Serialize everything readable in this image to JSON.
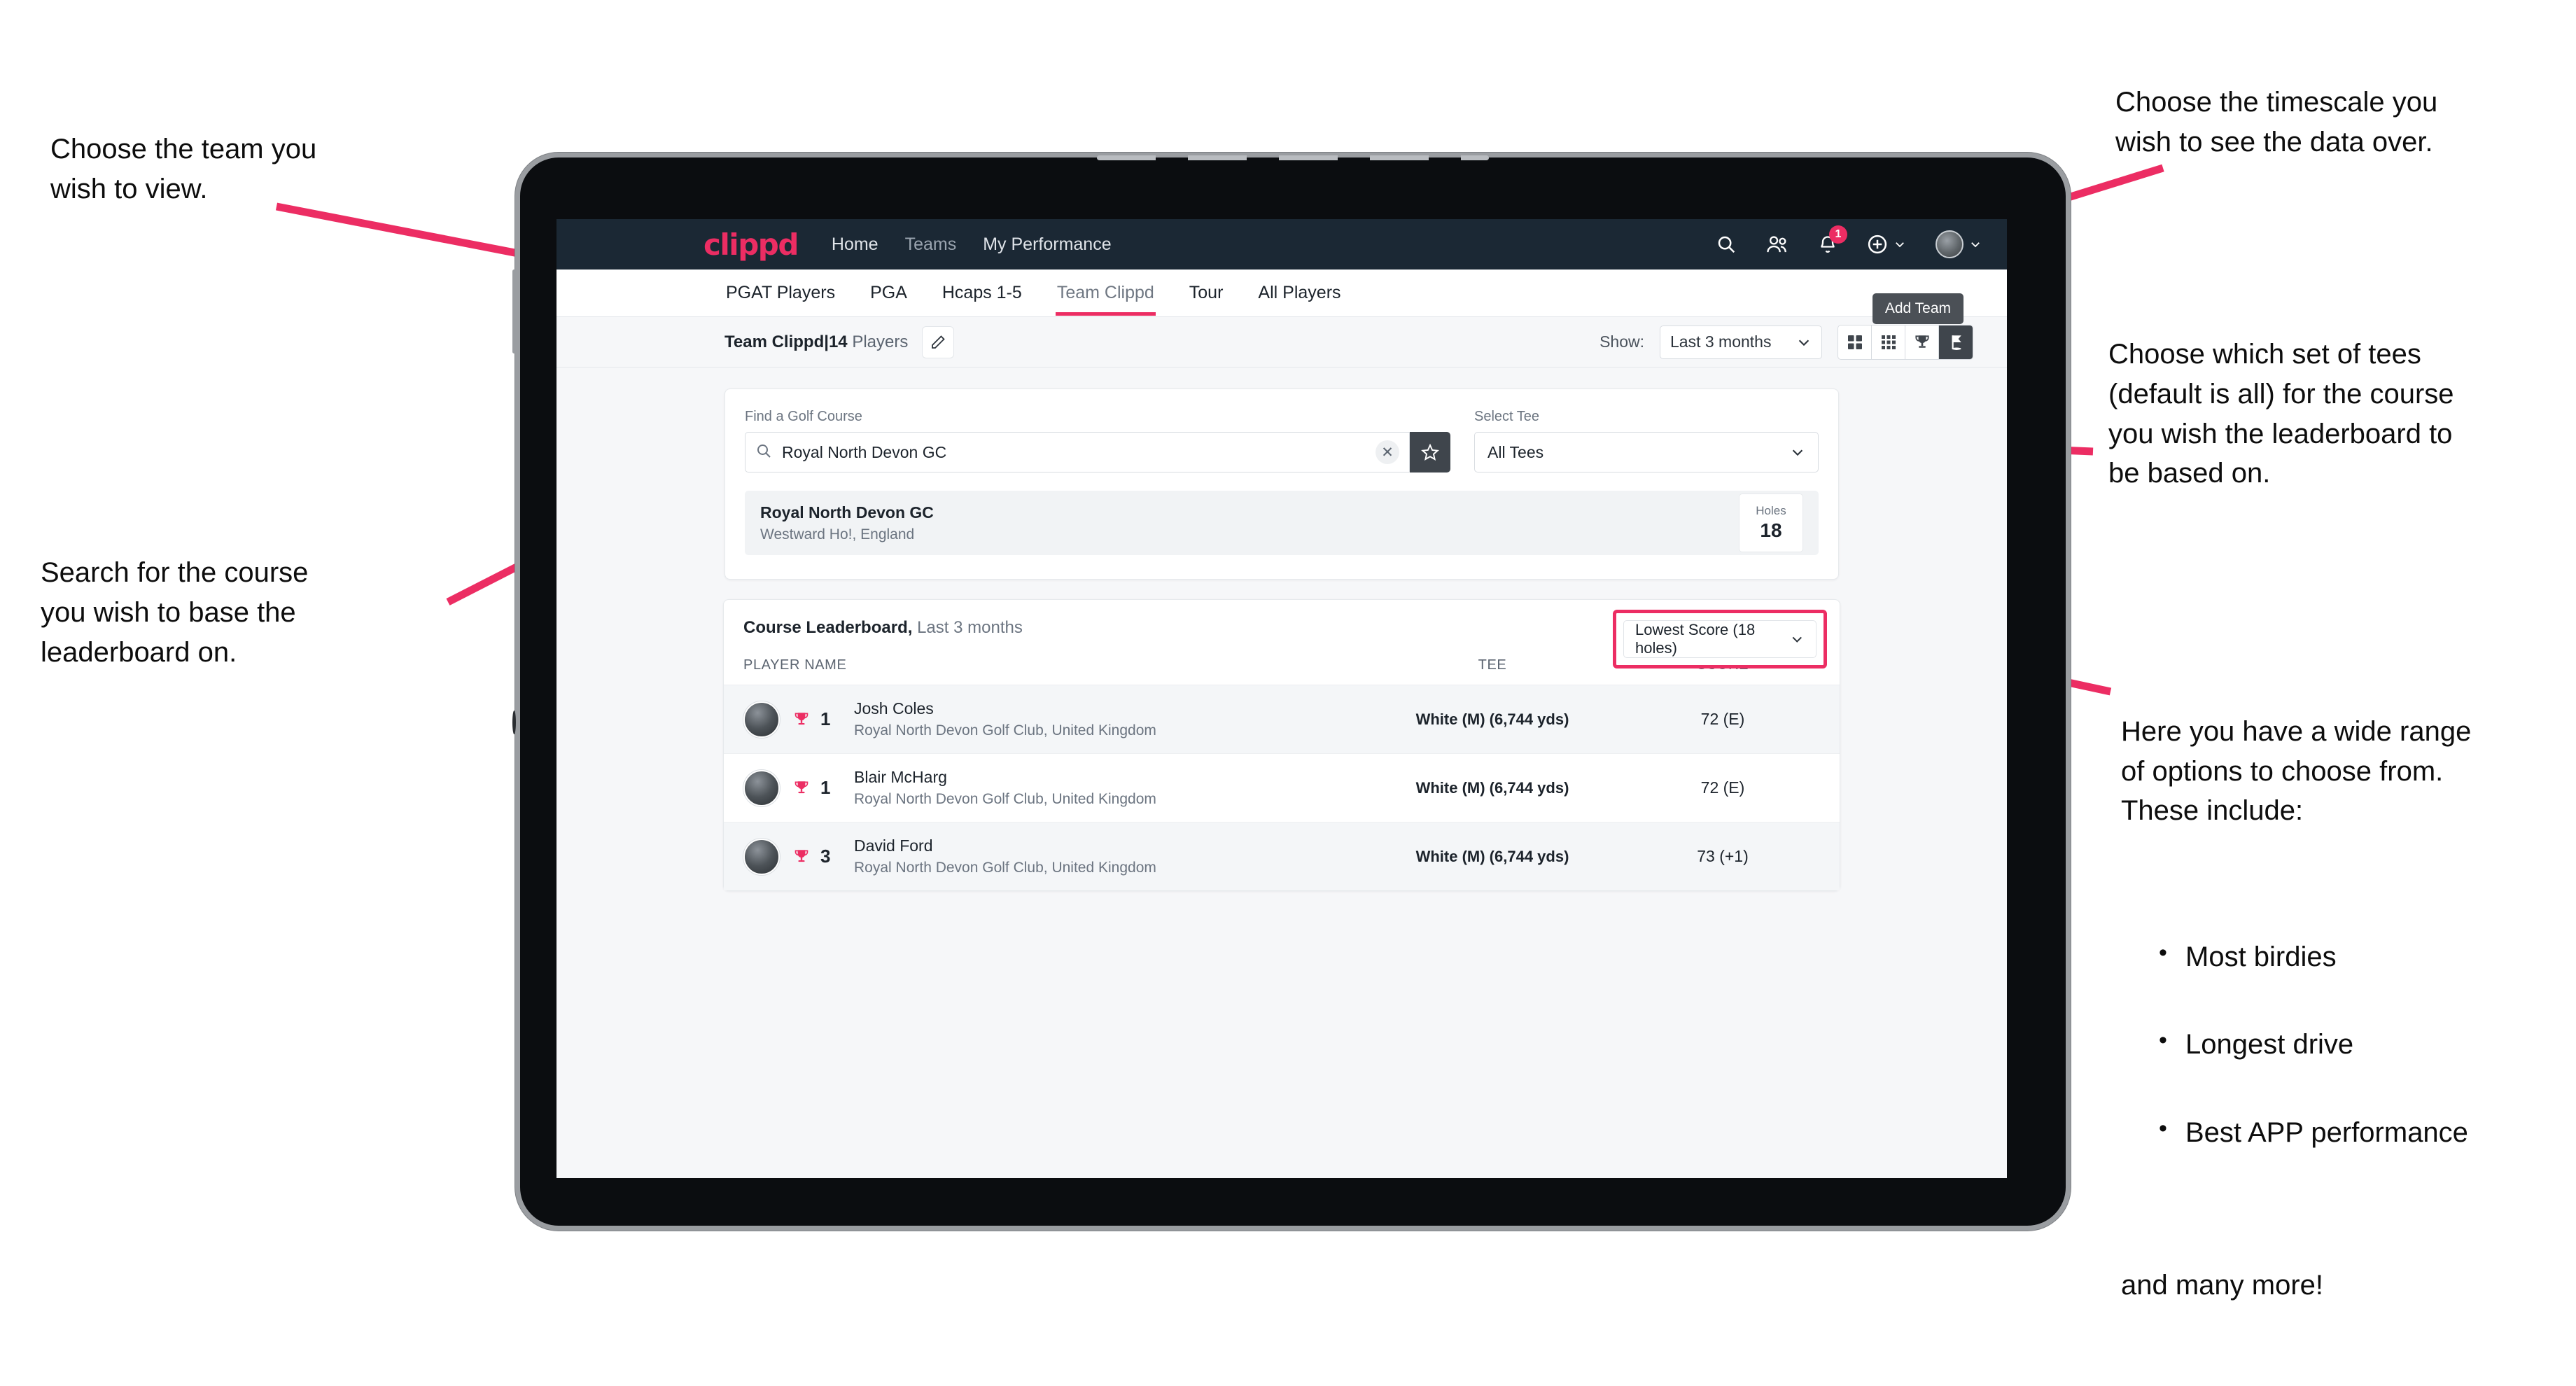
{
  "annotations": {
    "top_left": "Choose the team you\nwish to view.",
    "mid_left": "Search for the course\nyou wish to base the\nleaderboard on.",
    "top_right": "Choose the timescale you\nwish to see the data over.",
    "mid_right": "Choose which set of tees\n(default is all) for the course\nyou wish the leaderboard to\nbe based on.",
    "bottom_right_intro": "Here you have a wide range\nof options to choose from.\nThese include:",
    "bottom_right_bullets": [
      "Most birdies",
      "Longest drive",
      "Best APP performance"
    ],
    "bottom_right_tail": "and many more!"
  },
  "app": {
    "brand": "clippd",
    "nav_links": [
      {
        "label": "Home",
        "muted": false
      },
      {
        "label": "Teams",
        "muted": true
      },
      {
        "label": "My Performance",
        "muted": false
      }
    ],
    "nav_icons": [
      {
        "name": "search-icon"
      },
      {
        "name": "people-icon"
      },
      {
        "name": "notifications-bell-icon",
        "badge": "1"
      },
      {
        "name": "add-circle-icon"
      },
      {
        "name": "profile-avatar"
      }
    ],
    "tabs": [
      {
        "label": "PGAT Players",
        "active": false
      },
      {
        "label": "PGA",
        "active": false
      },
      {
        "label": "Hcaps 1-5",
        "active": false
      },
      {
        "label": "Team Clippd",
        "active": true
      },
      {
        "label": "Tour",
        "active": false
      },
      {
        "label": "All Players",
        "active": false
      }
    ],
    "tooltip": "Add Team",
    "toolbar": {
      "team_name": "Team Clippd",
      "separator": "|",
      "player_count": "14",
      "players_word": "Players",
      "edit_icon": "pencil-icon",
      "show_label": "Show:",
      "timescale_value": "Last 3 months",
      "view_toggles": [
        {
          "name": "grid-2x2-icon",
          "active": false
        },
        {
          "name": "grid-3x3-icon",
          "active": false
        },
        {
          "name": "trophy-icon",
          "active": false
        },
        {
          "name": "flag-icon",
          "active": true
        }
      ]
    },
    "search": {
      "course_label": "Find a Golf Course",
      "course_value": "Royal North Devon GC",
      "course_placeholder": "Find a Golf Course",
      "clear_icon": "close-icon",
      "favourite_icon": "star-icon",
      "tee_label": "Select Tee",
      "tee_value": "All Tees"
    },
    "course_result": {
      "name": "Royal North Devon GC",
      "location": "Westward Ho!, England",
      "holes_label": "Holes",
      "holes_value": "18"
    },
    "leaderboard": {
      "title": "Course Leaderboard,",
      "subtitle": "Last 3 months",
      "sort_value": "Lowest Score (18 holes)",
      "columns": [
        "PLAYER NAME",
        "TEE",
        "SCORE"
      ],
      "rows": [
        {
          "rank": "1",
          "name": "Josh Coles",
          "club": "Royal North Devon Golf Club, United Kingdom",
          "tee": "White (M) (6,744 yds)",
          "score": "72 (E)"
        },
        {
          "rank": "1",
          "name": "Blair McHarg",
          "club": "Royal North Devon Golf Club, United Kingdom",
          "tee": "White (M) (6,744 yds)",
          "score": "72 (E)"
        },
        {
          "rank": "3",
          "name": "David Ford",
          "club": "Royal North Devon Golf Club, United Kingdom",
          "tee": "White (M) (6,744 yds)",
          "score": "73 (+1)"
        }
      ]
    }
  },
  "colors": {
    "accent_pink": "#ec2d63",
    "nav_dark": "#1b2834",
    "toggle_active": "#3f454c"
  }
}
